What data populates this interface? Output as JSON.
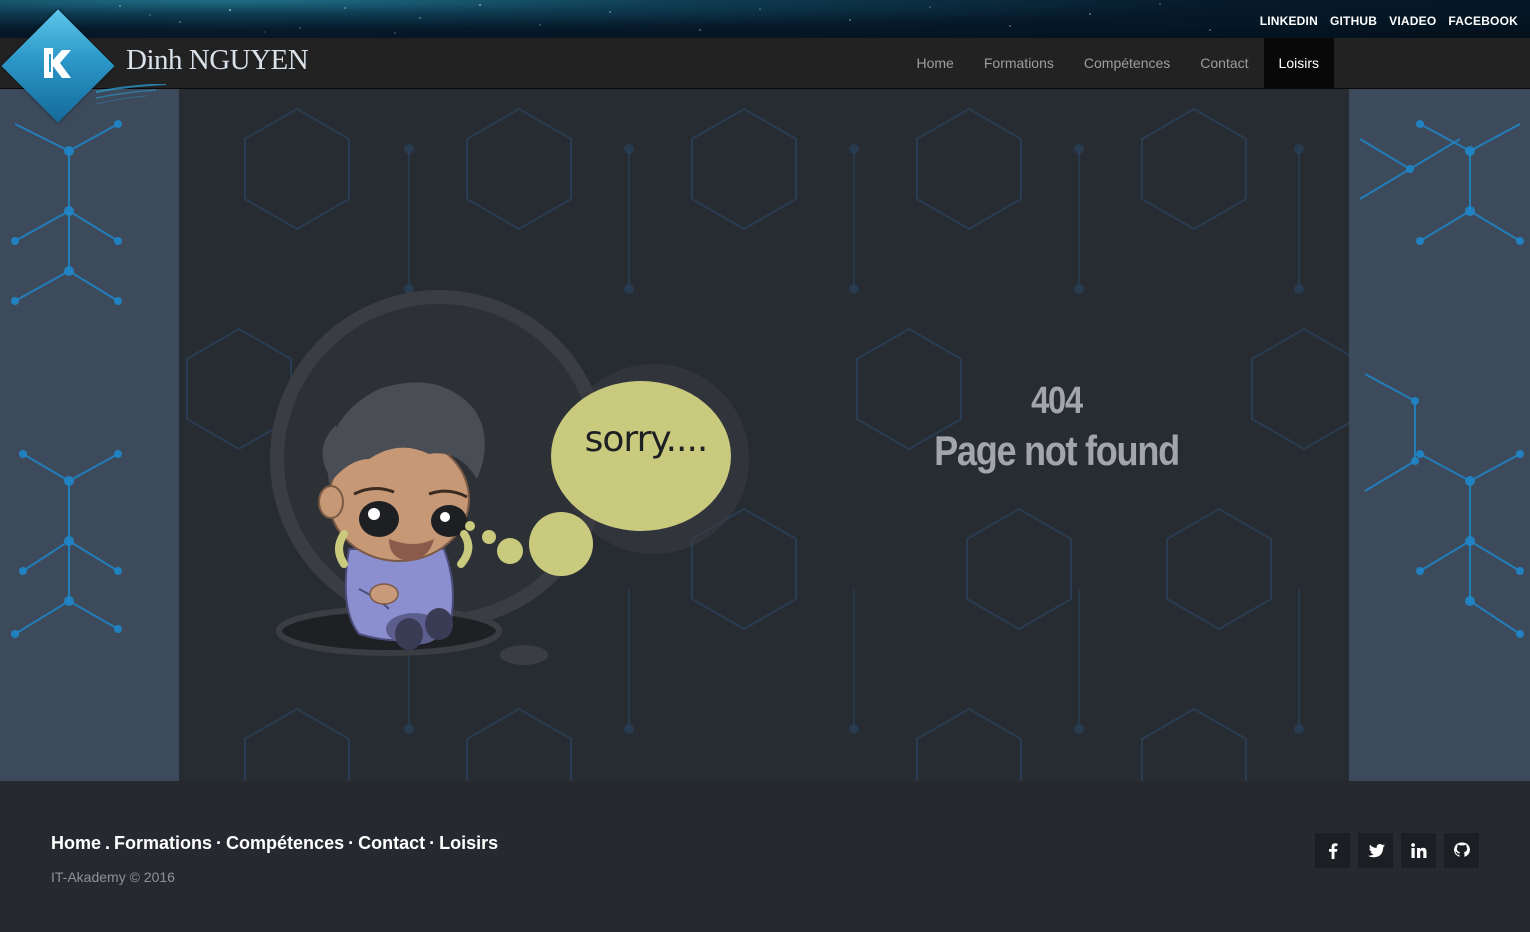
{
  "header": {
    "social_links": [
      "LINKEDIN",
      "GITHUB",
      "VIADEO",
      "FACEBOOK"
    ],
    "brand": "Dinh NGUYEN",
    "nav": [
      {
        "label": "Home",
        "active": false
      },
      {
        "label": "Formations",
        "active": false
      },
      {
        "label": "Compétences",
        "active": false
      },
      {
        "label": "Contact",
        "active": false
      },
      {
        "label": "Loisirs",
        "active": true
      }
    ]
  },
  "main": {
    "illustration_text": "sorry....",
    "error_code": "404",
    "error_message": "Page not found"
  },
  "footer": {
    "links": [
      "Home",
      "Formations",
      "Compétences",
      "Contact",
      "Loisirs"
    ],
    "copyright": "IT-Akademy © 2016",
    "social_icons": [
      "facebook-icon",
      "twitter-icon",
      "linkedin-icon",
      "github-icon"
    ]
  },
  "colors": {
    "accent": "#2b97c8",
    "bubble": "#c9ca7e",
    "navbar": "#222222",
    "active_nav": "#080808",
    "side_panel": "#3d4a5c",
    "content_bg": "#262a30"
  }
}
